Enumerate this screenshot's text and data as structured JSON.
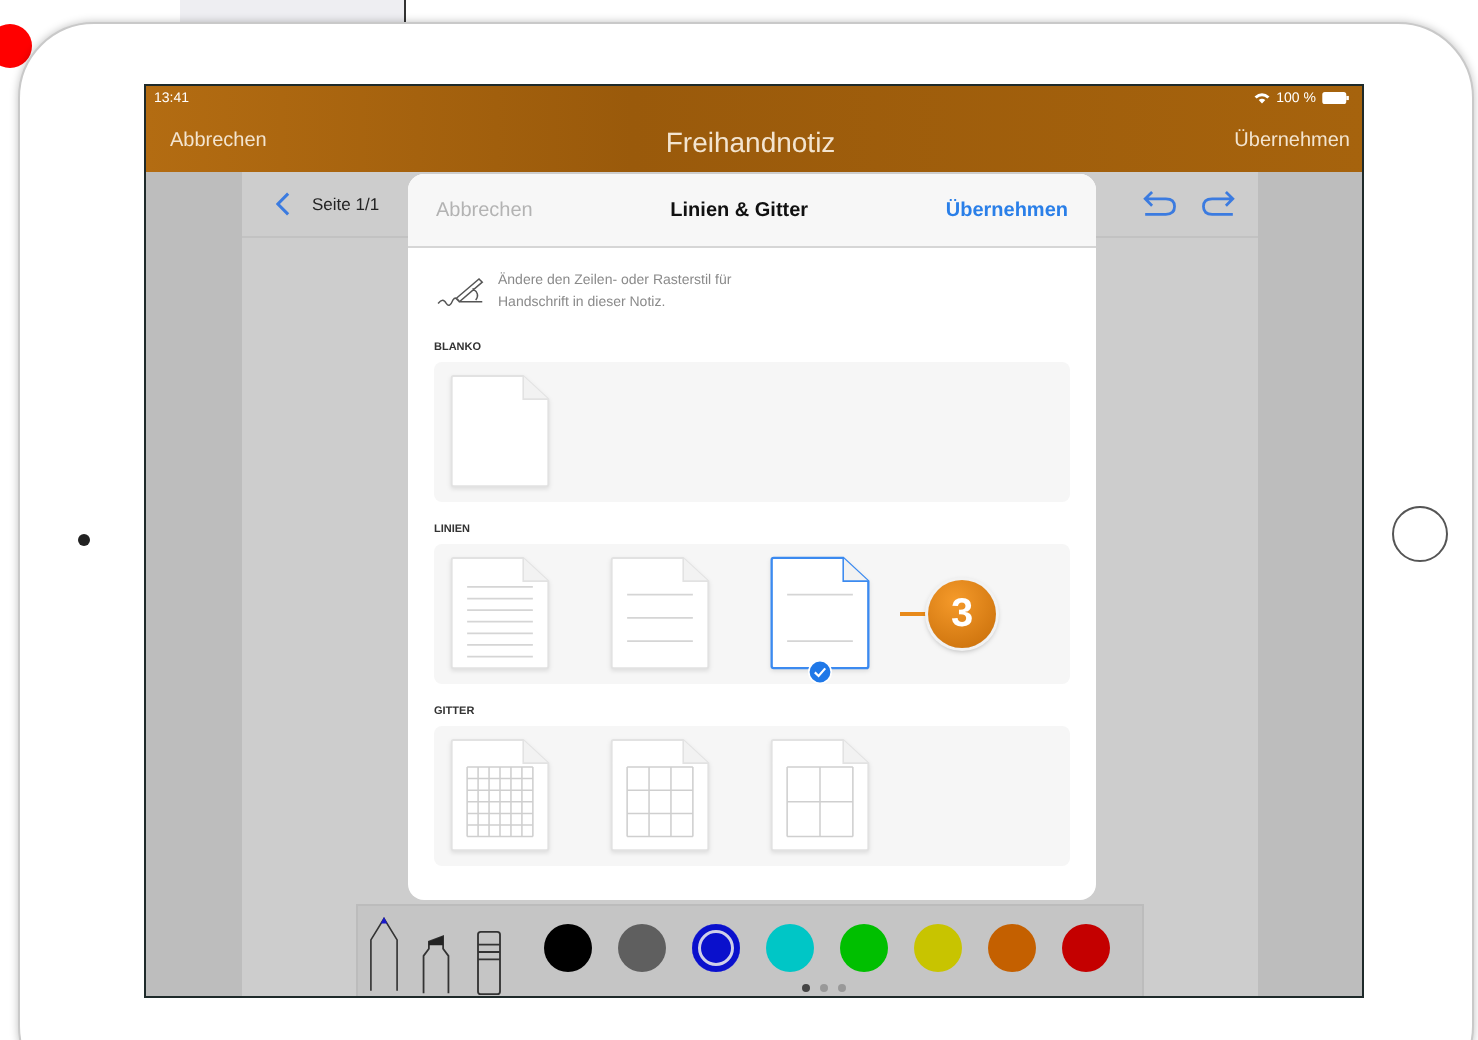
{
  "status_bar": {
    "time": "13:41",
    "battery": "100 %"
  },
  "nav_bar": {
    "cancel": "Abbrechen",
    "title": "Freihandnotiz",
    "apply": "Übernehmen"
  },
  "document_toolbar": {
    "page": "Seite 1/1"
  },
  "dialog": {
    "cancel": "Abbrechen",
    "title": "Linien & Gitter",
    "apply": "Übernehmen",
    "hint": "Ändere den Zeilen- oder Rasterstil für Handschrift in dieser Notiz.",
    "sections": [
      {
        "heading": "BLANKO",
        "templates": [
          {
            "kind": "blank",
            "selected": false
          }
        ]
      },
      {
        "heading": "LINIEN",
        "callout": "3",
        "templates": [
          {
            "kind": "lines-narrow",
            "selected": false
          },
          {
            "kind": "lines-medium",
            "selected": false
          },
          {
            "kind": "lines-wide",
            "selected": true
          }
        ]
      },
      {
        "heading": "GITTER",
        "templates": [
          {
            "kind": "grid-small",
            "selected": false
          },
          {
            "kind": "grid-medium",
            "selected": false
          },
          {
            "kind": "grid-large",
            "selected": false
          }
        ]
      }
    ]
  },
  "palette": {
    "colors": [
      {
        "color": "#000000",
        "selected": false
      },
      {
        "color": "#5f5f5f",
        "selected": false
      },
      {
        "color": "#0a10cc",
        "selected": true
      },
      {
        "color": "#00c6c6",
        "selected": false
      },
      {
        "color": "#00bf00",
        "selected": false
      },
      {
        "color": "#c8c400",
        "selected": false
      },
      {
        "color": "#c46000",
        "selected": false
      },
      {
        "color": "#c40000",
        "selected": false
      }
    ],
    "page_dots": [
      {
        "selected": true
      },
      {
        "selected": false
      },
      {
        "selected": false
      }
    ]
  }
}
